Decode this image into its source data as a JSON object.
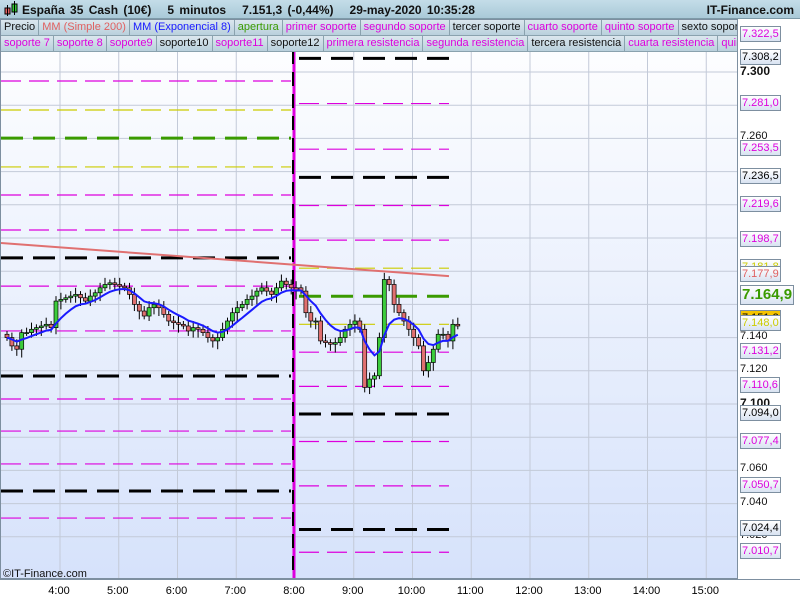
{
  "header": {
    "title": "España 35 Cash (10€)",
    "timeframe": "5 minutos",
    "price": "7.151,3 (-0,44%)",
    "datetime": "29-may-2020 10:35:28",
    "brand": "IT-Finance.com"
  },
  "legend_row1": [
    {
      "label": "Precio",
      "color": "#111111"
    },
    {
      "label": "MM (Simple 200)",
      "color": "#e06060"
    },
    {
      "label": "MM (Exponencial 8)",
      "color": "#1a1aff"
    },
    {
      "label": "apertura",
      "color": "#3a9a00"
    },
    {
      "label": "primer soporte",
      "color": "#dd00dd"
    },
    {
      "label": "segundo soporte",
      "color": "#dd00dd"
    },
    {
      "label": "tercer soporte",
      "color": "#111111"
    },
    {
      "label": "cuarto soporte",
      "color": "#dd00dd"
    },
    {
      "label": "quinto soporte",
      "color": "#dd00dd"
    },
    {
      "label": "sexto soporte",
      "color": "#111111"
    }
  ],
  "legend_row2": [
    {
      "label": "soporte 7",
      "color": "#dd00dd"
    },
    {
      "label": "soporte 8",
      "color": "#dd00dd"
    },
    {
      "label": "soporte9",
      "color": "#dd00dd"
    },
    {
      "label": "soporte10",
      "color": "#111111"
    },
    {
      "label": "soporte11",
      "color": "#dd00dd"
    },
    {
      "label": "soporte12",
      "color": "#111111"
    },
    {
      "label": "primera resistencia",
      "color": "#dd00dd"
    },
    {
      "label": "segunda resistencia",
      "color": "#dd00dd"
    },
    {
      "label": "tercera resistencia",
      "color": "#111111"
    },
    {
      "label": "cuarta resistencia",
      "color": "#dd00dd"
    },
    {
      "label": "quinta r",
      "color": "#dd00dd"
    }
  ],
  "copyright": "©IT-Finance.com",
  "chart_data": {
    "type": "candlestick",
    "ylim": [
      6980,
      7330
    ],
    "y_ticks": [
      {
        "v": 7300,
        "l": "7.300",
        "bold": true
      },
      {
        "v": 7260,
        "l": "7.260"
      },
      {
        "v": 7140,
        "l": "7.140"
      },
      {
        "v": 7120,
        "l": "7.120"
      },
      {
        "v": 7100,
        "l": "7.100",
        "bold": true
      },
      {
        "v": 7060,
        "l": "7.060"
      },
      {
        "v": 7040,
        "l": "7.040"
      },
      {
        "v": 7020,
        "l": "7.020"
      }
    ],
    "grid_prices": [
      7300,
      7280,
      7260,
      7240,
      7220,
      7200,
      7180,
      7160,
      7140,
      7120,
      7100,
      7080,
      7060,
      7040,
      7020
    ],
    "x_ticks": [
      "4:00",
      "5:00",
      "6:00",
      "7:00",
      "8:00",
      "9:00",
      "10:00",
      "11:00",
      "12:00",
      "13:00",
      "14:00",
      "15:00"
    ],
    "prev_session_closes": [
      7140,
      7135,
      7133,
      7143,
      7143,
      7145,
      7146,
      7147,
      7148,
      7146,
      7162,
      7163,
      7164,
      7165,
      7166,
      7164,
      7162,
      7165,
      7167,
      7170,
      7172,
      7173,
      7172,
      7171,
      7170,
      7166,
      7160,
      7156,
      7153,
      7158,
      7160,
      7158,
      7154,
      7150,
      7149,
      7148,
      7147,
      7144,
      7146,
      7145,
      7143,
      7140,
      7138,
      7140,
      7145,
      7150,
      7155,
      7158,
      7160,
      7163,
      7165,
      7168,
      7170,
      7168,
      7166,
      7170,
      7174,
      7172,
      7170,
      7168
    ],
    "today_closes": [
      7168,
      7155,
      7150,
      7150,
      7138,
      7137,
      7136,
      7137,
      7140,
      7145,
      7148,
      7150,
      7145,
      7110,
      7115,
      7117,
      7140,
      7175,
      7172,
      7160,
      7155,
      7150,
      7145,
      7140,
      7135,
      7120,
      7125,
      7133,
      7142,
      7142,
      7138,
      7148,
      7147
    ],
    "ma200": {
      "start": 7197,
      "end": 7177
    },
    "prev_levels": [
      {
        "p": 7294.6,
        "c": "#dd00dd"
      },
      {
        "p": 7277.1,
        "c": "#cccc00"
      },
      {
        "p": 7260.2,
        "c": "#3a9a00",
        "thick": true
      },
      {
        "p": 7242.8,
        "c": "#cccc00"
      },
      {
        "p": 7225.9,
        "c": "#dd00dd"
      },
      {
        "p": 7204.8,
        "c": "#dd00dd"
      },
      {
        "p": 7188,
        "c": "#000000",
        "thick": true
      },
      {
        "p": 7171,
        "c": "#dd00dd"
      },
      {
        "p": 7144,
        "c": "#dd00dd"
      },
      {
        "p": 7116.9,
        "c": "#000000",
        "thick": true
      },
      {
        "p": 7103,
        "c": "#dd00dd"
      },
      {
        "p": 7083.7,
        "c": "#dd00dd"
      },
      {
        "p": 7063.9,
        "c": "#dd00dd"
      },
      {
        "p": 7047.6,
        "c": "#000000",
        "thick": true
      },
      {
        "p": 7031.3,
        "c": "#dd00dd"
      }
    ],
    "price_labels": [
      {
        "p": 7322.5,
        "l": "7.322,5",
        "c": "#dd00dd",
        "line": false
      },
      {
        "p": 7308.2,
        "l": "7.308,2",
        "c": "#000000",
        "line": true,
        "thick": true
      },
      {
        "p": 7281.0,
        "l": "7.281,0",
        "c": "#dd00dd",
        "line": true
      },
      {
        "p": 7253.5,
        "l": "7.253,5",
        "c": "#dd00dd",
        "line": true
      },
      {
        "p": 7236.5,
        "l": "7.236,5",
        "c": "#000000",
        "line": true,
        "thick": true
      },
      {
        "p": 7219.6,
        "l": "7.219,6",
        "c": "#dd00dd",
        "line": true
      },
      {
        "p": 7198.7,
        "l": "7.198,7",
        "c": "#dd00dd",
        "line": true
      },
      {
        "p": 7181.8,
        "l": "7.181,8",
        "c": "#cccc00",
        "line": true
      },
      {
        "p": 7177.9,
        "l": "7.177,9",
        "c": "#e06060",
        "line": false
      },
      {
        "p": 7164.9,
        "l": "7.164,9",
        "c": "#3a9a00",
        "line": true,
        "thick": true,
        "big": true
      },
      {
        "p": 7151.3,
        "l": "7.151,3",
        "c": "#000000",
        "line": false,
        "bg": "#f5c400"
      },
      {
        "p": 7148.0,
        "l": "7.148,0",
        "c": "#cccc00",
        "line": true
      },
      {
        "p": 7131.2,
        "l": "7.131,2",
        "c": "#dd00dd",
        "line": true
      },
      {
        "p": 7110.6,
        "l": "7.110,6",
        "c": "#dd00dd",
        "line": true
      },
      {
        "p": 7094.0,
        "l": "7.094,0",
        "c": "#000000",
        "line": true,
        "thick": true
      },
      {
        "p": 7077.4,
        "l": "7.077,4",
        "c": "#dd00dd",
        "line": true
      },
      {
        "p": 7050.7,
        "l": "7.050,7",
        "c": "#dd00dd",
        "line": true
      },
      {
        "p": 7024.4,
        "l": "7.024,4",
        "c": "#000000",
        "line": true,
        "thick": true
      },
      {
        "p": 7010.7,
        "l": "7.010,7",
        "c": "#dd00dd",
        "line": true
      }
    ]
  }
}
